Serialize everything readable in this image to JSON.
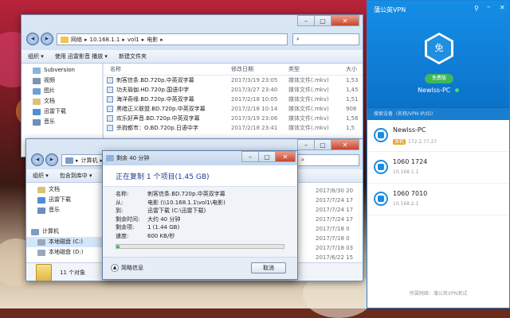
{
  "explorer_back": {
    "breadcrumb": [
      "网络",
      "10.168.1.1",
      "vol1",
      "电影"
    ],
    "toolbar": [
      "组织 ▾",
      "使用 迅雷影音 播放 ▾",
      "新建文件夹"
    ],
    "tree": [
      "Subversion",
      "视频",
      "图片",
      "文档",
      "迅雷下载",
      "音乐"
    ],
    "columns": [
      "名称",
      "修改日期",
      "类型",
      "大小"
    ],
    "rows": [
      {
        "name": "刺客信条.BD.720p.中英双字幕",
        "date": "2017/3/19 23:05",
        "type": "媒体文件(.mkv)",
        "size": "1,53"
      },
      {
        "name": "功夫瑜伽.HD.720p.国语中字",
        "date": "2017/3/27 23:40",
        "type": "媒体文件(.mkv)",
        "size": "1,45"
      },
      {
        "name": "海洋奇缘.BD.720p.中英双字幕",
        "date": "2017/2/18 10:05",
        "type": "媒体文件(.mkv)",
        "size": "1,51"
      },
      {
        "name": "黑暗正义联盟.BD.720p.中英双字幕",
        "date": "2017/2/18 10:14",
        "type": "媒体文件(.mkv)",
        "size": "908"
      },
      {
        "name": "欢乐好声音.BD.720p.中英双字幕",
        "date": "2017/3/19 23:06",
        "type": "媒体文件(.mkv)",
        "size": "1,56"
      },
      {
        "name": "杀戮都市：O.BD.720p.日语中字",
        "date": "2017/2/18 23:41",
        "type": "媒体文件(.mkv)",
        "size": "1,5"
      }
    ]
  },
  "explorer_front": {
    "breadcrumb": [
      "计算机"
    ],
    "toolbar": [
      "组织 ▾",
      "包含到库中 ▾"
    ],
    "tree": [
      "文档",
      "迅雷下载",
      "音乐",
      "计算机",
      "本地磁盘 (C:)",
      "本地磁盘 (D:)"
    ],
    "dates": [
      "2017/8/30 20",
      "2017/7/24 17",
      "2017/7/24 17",
      "2017/7/24 17",
      "2017/7/18 0",
      "2017/7/18 0",
      "2017/7/18 03",
      "2017/6/22 15",
      "2017/6/22 15"
    ],
    "status": "11 个对象"
  },
  "copy_dialog": {
    "title": "剩余 40 分钟",
    "heading": "正在复制 1 个项目(1.45 GB)",
    "fields": [
      {
        "k": "名称:",
        "v": "刺客信条.BD.720p.中英双字幕"
      },
      {
        "k": "从:",
        "v": "电影 (\\\\10.168.1.1\\vol1\\电影)"
      },
      {
        "k": "到:",
        "v": "迅雷下载 (C:\\迅雷下载)"
      },
      {
        "k": "剩余时间:",
        "v": "大约 40 分钟"
      },
      {
        "k": "剩余项:",
        "v": "1 (1.44 GB)"
      },
      {
        "k": "速度:",
        "v": "600 KB/秒"
      }
    ],
    "progress": 0.02,
    "more_label": "简略信息",
    "cancel_label": "取消"
  },
  "vpn": {
    "title": "蒲公英VPN",
    "hex_label": "免",
    "badge": "免费版",
    "device": "Newlss-PC",
    "search_placeholder": "搜索设备（名称/VPN IP/ID）",
    "items": [
      {
        "name": "Newlss-PC",
        "tag": "本机",
        "ip": "172.2.77.27"
      },
      {
        "name": "1060      1724",
        "tag": "",
        "ip": "10.168.1.1"
      },
      {
        "name": "1060      7010",
        "tag": "",
        "ip": "10.168.2.1"
      }
    ],
    "footer": "所属网络：蒲公英VPN测试"
  }
}
